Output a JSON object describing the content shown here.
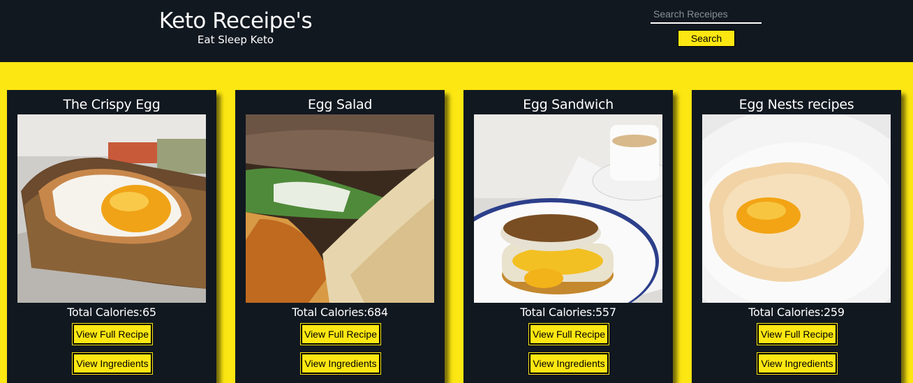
{
  "header": {
    "title": "Keto Receipe's",
    "subtitle": "Eat Sleep Keto",
    "search_placeholder": "Search Receipes",
    "search_button": "Search"
  },
  "recipes": [
    {
      "title": "The Crispy Egg",
      "calories": "Total Calories:65",
      "full_recipe": "View Full Recipe",
      "ingredients": "View Ingredients"
    },
    {
      "title": "Egg Salad",
      "calories": "Total Calories:684",
      "full_recipe": "View Full Recipe",
      "ingredients": "View Ingredients"
    },
    {
      "title": "Egg Sandwich",
      "calories": "Total Calories:557",
      "full_recipe": "View Full Recipe",
      "ingredients": "View Ingredients"
    },
    {
      "title": "Egg Nests recipes",
      "calories": "Total Calories:259",
      "full_recipe": "View Full Recipe",
      "ingredients": "View Ingredients"
    }
  ],
  "colors": {
    "header_bg": "#111820",
    "accent": "#fde712"
  }
}
